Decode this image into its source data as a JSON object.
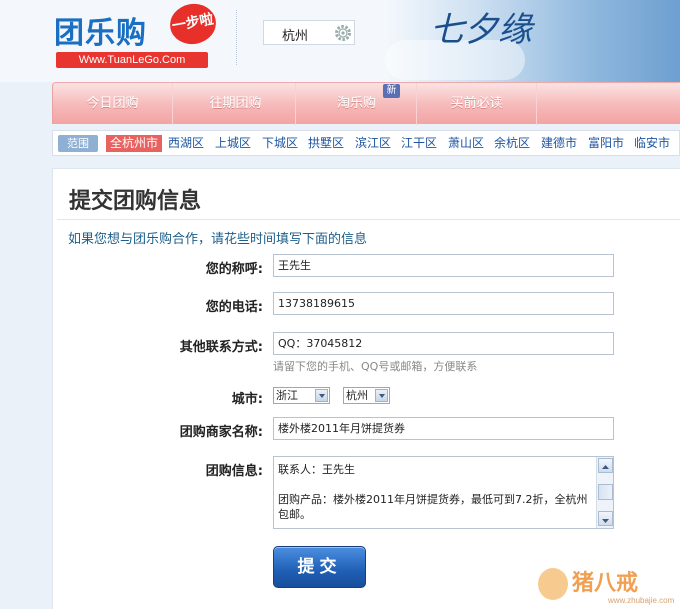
{
  "header": {
    "logo_text": "团乐购",
    "logo_badge": "一步啦",
    "logo_url": "Www.TuanLeGo.Com",
    "city": "杭州",
    "banner_title": "七夕缘"
  },
  "nav": {
    "items": [
      {
        "label": "今日团购"
      },
      {
        "label": "往期团购"
      },
      {
        "label": "淘乐购",
        "badge": "新"
      },
      {
        "label": "买前必读"
      }
    ]
  },
  "district_bar": {
    "label": "范围",
    "items": [
      "全杭州市",
      "西湖区",
      "上城区",
      "下城区",
      "拱墅区",
      "滨江区",
      "江干区",
      "萧山区",
      "余杭区",
      "建德市",
      "富阳市",
      "临安市"
    ],
    "active_index": 0
  },
  "form": {
    "title": "提交团购信息",
    "intro": "如果您想与团乐购合作，请花些时间填写下面的信息",
    "name_label": "您的称呼:",
    "name_value": "王先生",
    "phone_label": "您的电话:",
    "phone_value": "13738189615",
    "contact_label": "其他联系方式:",
    "contact_value": "QQ：37045812",
    "contact_hint": "请留下您的手机、QQ号或邮箱，方便联系",
    "city_label": "城市:",
    "province_select": "浙江",
    "city_select": "杭州",
    "merchant_label": "团购商家名称:",
    "merchant_value": "楼外楼2011年月饼提货券",
    "info_label": "团购信息:",
    "info_line1": "联系人：王先生",
    "info_line2": "团购产品：楼外楼2011年月饼提货券，最低可到7.2折，全杭州包邮。",
    "submit_label": "提交"
  },
  "watermark": {
    "text": "猪八戒",
    "url": "www.zhubajie.com"
  }
}
